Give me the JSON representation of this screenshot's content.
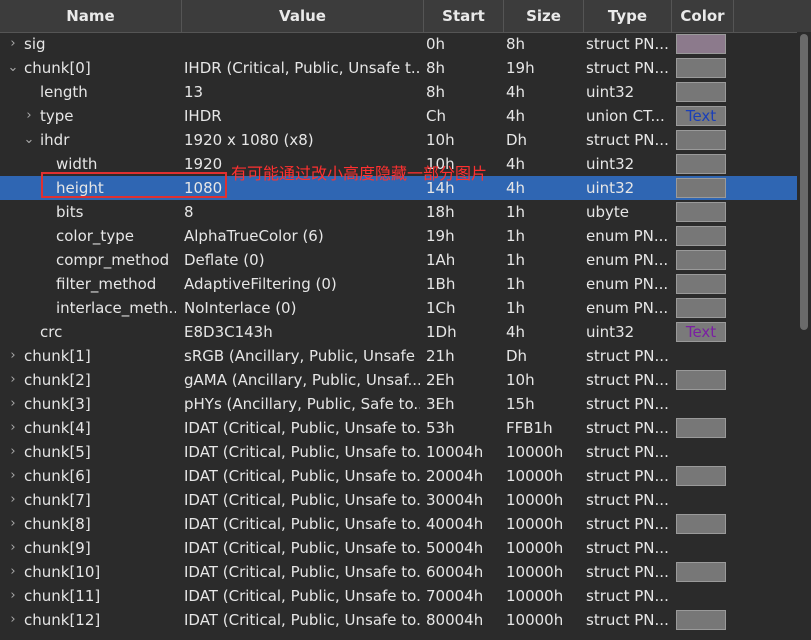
{
  "columns": {
    "name": "Name",
    "value": "Value",
    "start": "Start",
    "size": "Size",
    "type": "Type",
    "color": "Color"
  },
  "rows": [
    {
      "indent": 0,
      "arrow": "›",
      "name": "sig",
      "value": "",
      "start": "0h",
      "size": "8h",
      "type": "struct PN...",
      "color": "swatch-purple"
    },
    {
      "indent": 0,
      "arrow": "⌄",
      "name": "chunk[0]",
      "value": "IHDR  (Critical, Public, Unsafe t...",
      "start": "8h",
      "size": "19h",
      "type": "struct PN...",
      "color": "swatch"
    },
    {
      "indent": 1,
      "arrow": "",
      "name": "length",
      "value": "13",
      "start": "8h",
      "size": "4h",
      "type": "uint32",
      "color": "swatch"
    },
    {
      "indent": 1,
      "arrow": "›",
      "name": "type",
      "value": "IHDR",
      "start": "Ch",
      "size": "4h",
      "type": "union CT...",
      "color": "text-blue"
    },
    {
      "indent": 1,
      "arrow": "⌄",
      "name": "ihdr",
      "value": "1920 x 1080 (x8)",
      "start": "10h",
      "size": "Dh",
      "type": "struct PN...",
      "color": "swatch"
    },
    {
      "indent": 2,
      "arrow": "",
      "name": "width",
      "value": "1920",
      "start": "10h",
      "size": "4h",
      "type": "uint32",
      "color": "swatch"
    },
    {
      "indent": 2,
      "arrow": "",
      "name": "height",
      "value": "1080",
      "start": "14h",
      "size": "4h",
      "type": "uint32",
      "color": "swatch",
      "selected": true
    },
    {
      "indent": 2,
      "arrow": "",
      "name": "bits",
      "value": "8",
      "start": "18h",
      "size": "1h",
      "type": "ubyte",
      "color": "swatch"
    },
    {
      "indent": 2,
      "arrow": "",
      "name": "color_type",
      "value": "AlphaTrueColor (6)",
      "start": "19h",
      "size": "1h",
      "type": "enum PN...",
      "color": "swatch"
    },
    {
      "indent": 2,
      "arrow": "",
      "name": "compr_method",
      "value": "Deflate (0)",
      "start": "1Ah",
      "size": "1h",
      "type": "enum PN...",
      "color": "swatch"
    },
    {
      "indent": 2,
      "arrow": "",
      "name": "filter_method",
      "value": "AdaptiveFiltering (0)",
      "start": "1Bh",
      "size": "1h",
      "type": "enum PN...",
      "color": "swatch"
    },
    {
      "indent": 2,
      "arrow": "",
      "name": "interlace_meth...",
      "value": "NoInterlace (0)",
      "start": "1Ch",
      "size": "1h",
      "type": "enum PN...",
      "color": "swatch"
    },
    {
      "indent": 1,
      "arrow": "",
      "name": "crc",
      "value": "E8D3C143h",
      "start": "1Dh",
      "size": "4h",
      "type": "uint32",
      "color": "text-purple"
    },
    {
      "indent": 0,
      "arrow": "›",
      "name": "chunk[1]",
      "value": "sRGB  (Ancillary, Public, Unsafe ...",
      "start": "21h",
      "size": "Dh",
      "type": "struct PN...",
      "color": "none"
    },
    {
      "indent": 0,
      "arrow": "›",
      "name": "chunk[2]",
      "value": "gAMA  (Ancillary, Public, Unsaf...",
      "start": "2Eh",
      "size": "10h",
      "type": "struct PN...",
      "color": "swatch"
    },
    {
      "indent": 0,
      "arrow": "›",
      "name": "chunk[3]",
      "value": "pHYs  (Ancillary, Public, Safe to...",
      "start": "3Eh",
      "size": "15h",
      "type": "struct PN...",
      "color": "none"
    },
    {
      "indent": 0,
      "arrow": "›",
      "name": "chunk[4]",
      "value": "IDAT  (Critical, Public, Unsafe to...",
      "start": "53h",
      "size": "FFB1h",
      "type": "struct PN...",
      "color": "swatch"
    },
    {
      "indent": 0,
      "arrow": "›",
      "name": "chunk[5]",
      "value": "IDAT  (Critical, Public, Unsafe to...",
      "start": "10004h",
      "size": "10000h",
      "type": "struct PN...",
      "color": "none"
    },
    {
      "indent": 0,
      "arrow": "›",
      "name": "chunk[6]",
      "value": "IDAT  (Critical, Public, Unsafe to...",
      "start": "20004h",
      "size": "10000h",
      "type": "struct PN...",
      "color": "swatch"
    },
    {
      "indent": 0,
      "arrow": "›",
      "name": "chunk[7]",
      "value": "IDAT  (Critical, Public, Unsafe to...",
      "start": "30004h",
      "size": "10000h",
      "type": "struct PN...",
      "color": "none"
    },
    {
      "indent": 0,
      "arrow": "›",
      "name": "chunk[8]",
      "value": "IDAT  (Critical, Public, Unsafe to...",
      "start": "40004h",
      "size": "10000h",
      "type": "struct PN...",
      "color": "swatch"
    },
    {
      "indent": 0,
      "arrow": "›",
      "name": "chunk[9]",
      "value": "IDAT  (Critical, Public, Unsafe to...",
      "start": "50004h",
      "size": "10000h",
      "type": "struct PN...",
      "color": "none"
    },
    {
      "indent": 0,
      "arrow": "›",
      "name": "chunk[10]",
      "value": "IDAT  (Critical, Public, Unsafe to...",
      "start": "60004h",
      "size": "10000h",
      "type": "struct PN...",
      "color": "swatch"
    },
    {
      "indent": 0,
      "arrow": "›",
      "name": "chunk[11]",
      "value": "IDAT  (Critical, Public, Unsafe to...",
      "start": "70004h",
      "size": "10000h",
      "type": "struct PN...",
      "color": "none"
    },
    {
      "indent": 0,
      "arrow": "›",
      "name": "chunk[12]",
      "value": "IDAT  (Critical, Public, Unsafe to...",
      "start": "80004h",
      "size": "10000h",
      "type": "struct PN...",
      "color": "swatch"
    }
  ],
  "text_swatch_label": "Text",
  "annotation": "有可能通过改小高度隐藏一部分图片",
  "colors": {
    "background": "#2b2b2b",
    "header": "#3c3c3c",
    "selected": "#2f66b3",
    "annotation": "#ff3030",
    "swatch_gray": "#777777",
    "swatch_purple": "#8c7a8c",
    "text_blue": "#1a3fb8",
    "text_purple": "#7a1fa2"
  }
}
